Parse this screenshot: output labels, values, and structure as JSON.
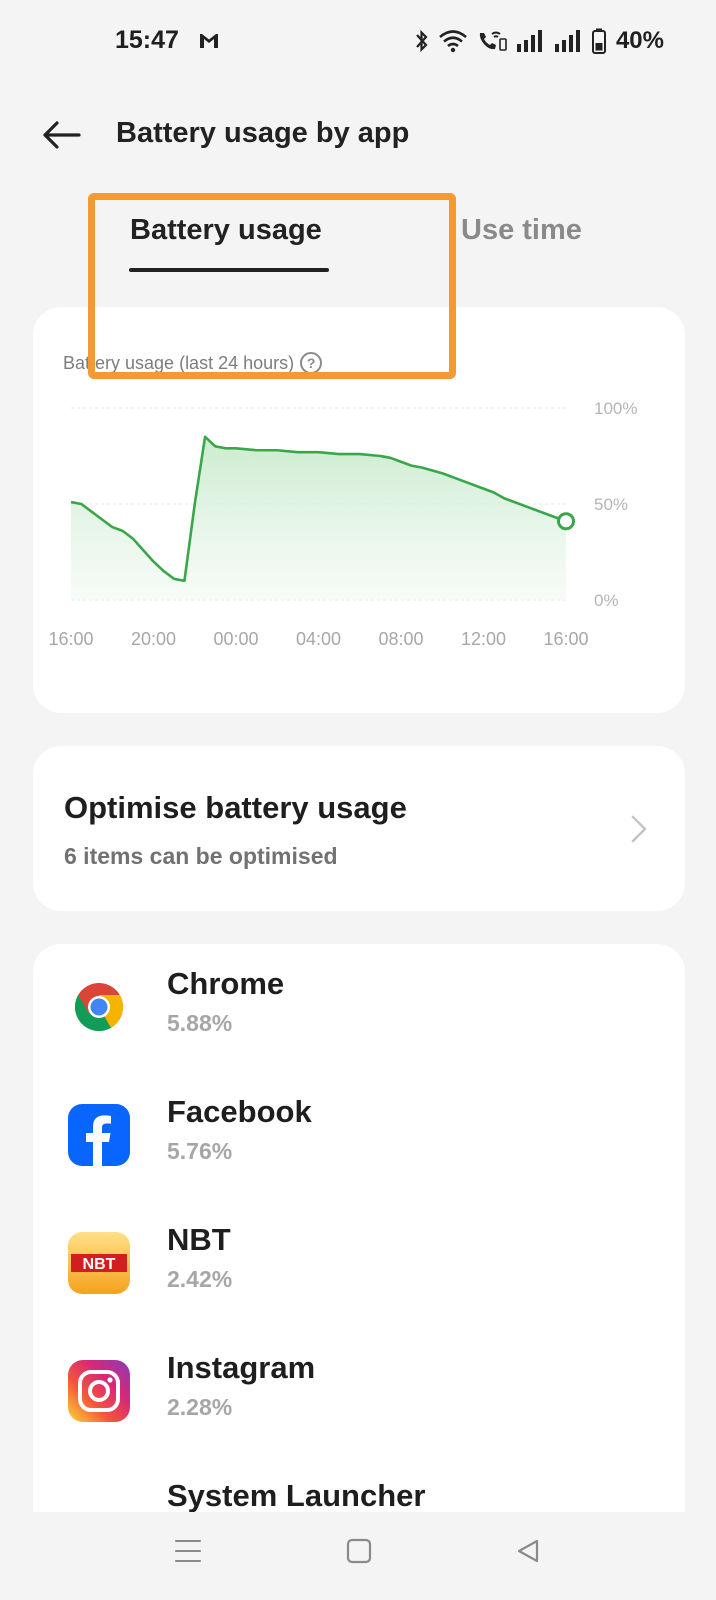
{
  "status": {
    "time": "15:47",
    "battery_percent": "40%",
    "icons": [
      "gmail-icon",
      "bluetooth-icon",
      "wifi-icon",
      "wifi-calling-icon",
      "signal-icon",
      "signal-icon",
      "battery-icon"
    ]
  },
  "header": {
    "title": "Battery usage by app",
    "back_icon": "arrow-left-icon"
  },
  "tabs": [
    {
      "label": "Battery usage",
      "active": true
    },
    {
      "label": "Use time",
      "active": false
    }
  ],
  "highlight_color": "#f39a33",
  "chart_card": {
    "title": "Battery usage (last 24 hours)",
    "help_glyph": "?"
  },
  "chart_data": {
    "type": "area",
    "title": "Battery usage (last 24 hours)",
    "x_tick_labels": [
      "16:00",
      "20:00",
      "00:00",
      "04:00",
      "08:00",
      "12:00",
      "16:00"
    ],
    "y_tick_labels": [
      "100%",
      "50%",
      "0%"
    ],
    "ylim": [
      0,
      100
    ],
    "xlim": [
      0,
      24
    ],
    "color": "#3aa64a",
    "fill_color": "#d6f0d9",
    "grid": true,
    "x": [
      0,
      0.5,
      1.0,
      1.5,
      2.0,
      2.5,
      3.0,
      3.5,
      4.0,
      4.5,
      5.0,
      5.5,
      6.0,
      6.5,
      7.0,
      7.5,
      8.0,
      9.0,
      10.0,
      11.0,
      12.0,
      13.0,
      14.0,
      15.0,
      15.5,
      16.0,
      16.5,
      17.0,
      18.0,
      19.0,
      20.0,
      20.5,
      21.0,
      22.0,
      23.0,
      24.0
    ],
    "y": [
      51,
      50,
      46,
      42,
      38,
      36,
      32,
      26,
      20,
      15,
      11,
      10,
      50,
      85,
      80,
      79,
      79,
      78,
      78,
      77,
      77,
      76,
      76,
      75,
      74,
      72,
      70,
      69,
      66,
      62,
      58,
      56,
      53,
      49,
      45,
      41
    ],
    "end_marker": true
  },
  "optimise": {
    "title": "Optimise battery usage",
    "subtitle": "6 items can be optimised"
  },
  "apps": [
    {
      "name": "Chrome",
      "percent": "5.88%",
      "icon": "chrome-icon"
    },
    {
      "name": "Facebook",
      "percent": "5.76%",
      "icon": "facebook-icon"
    },
    {
      "name": "NBT",
      "percent": "2.42%",
      "icon": "nbt-icon",
      "icon_text": "NBT"
    },
    {
      "name": "Instagram",
      "percent": "2.28%",
      "icon": "instagram-icon"
    },
    {
      "name": "System Launcher",
      "percent": "",
      "icon": ""
    }
  ],
  "nav": [
    "menu-icon",
    "home-icon",
    "back-triangle-icon"
  ]
}
